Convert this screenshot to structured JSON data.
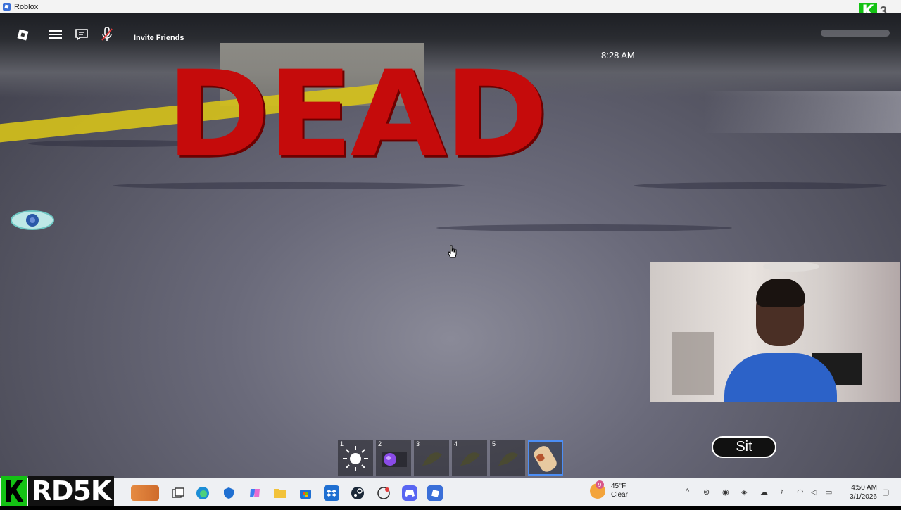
{
  "window": {
    "title": "Roblox"
  },
  "game": {
    "invite_label": "Invite Friends",
    "time": "8:28 AM",
    "banner": "DEAD",
    "sit_label": "Sit",
    "hotbar": [
      {
        "slot": "1",
        "item": "sun-icon"
      },
      {
        "slot": "2",
        "item": "purple-orb-icon"
      },
      {
        "slot": "3",
        "item": "taco-icon"
      },
      {
        "slot": "4",
        "item": "taco-icon"
      },
      {
        "slot": "5",
        "item": "taco-icon"
      },
      {
        "slot": "",
        "item": "burrito-icon",
        "selected": true
      }
    ]
  },
  "overlay": {
    "logo_text": "RD5K",
    "badge": "K",
    "badge_num": "3"
  },
  "taskbar": {
    "weather_temp": "45°F",
    "weather_desc": "Clear",
    "time": "4:50 AM",
    "date": "3/1/2026",
    "weather_badge": "9"
  }
}
